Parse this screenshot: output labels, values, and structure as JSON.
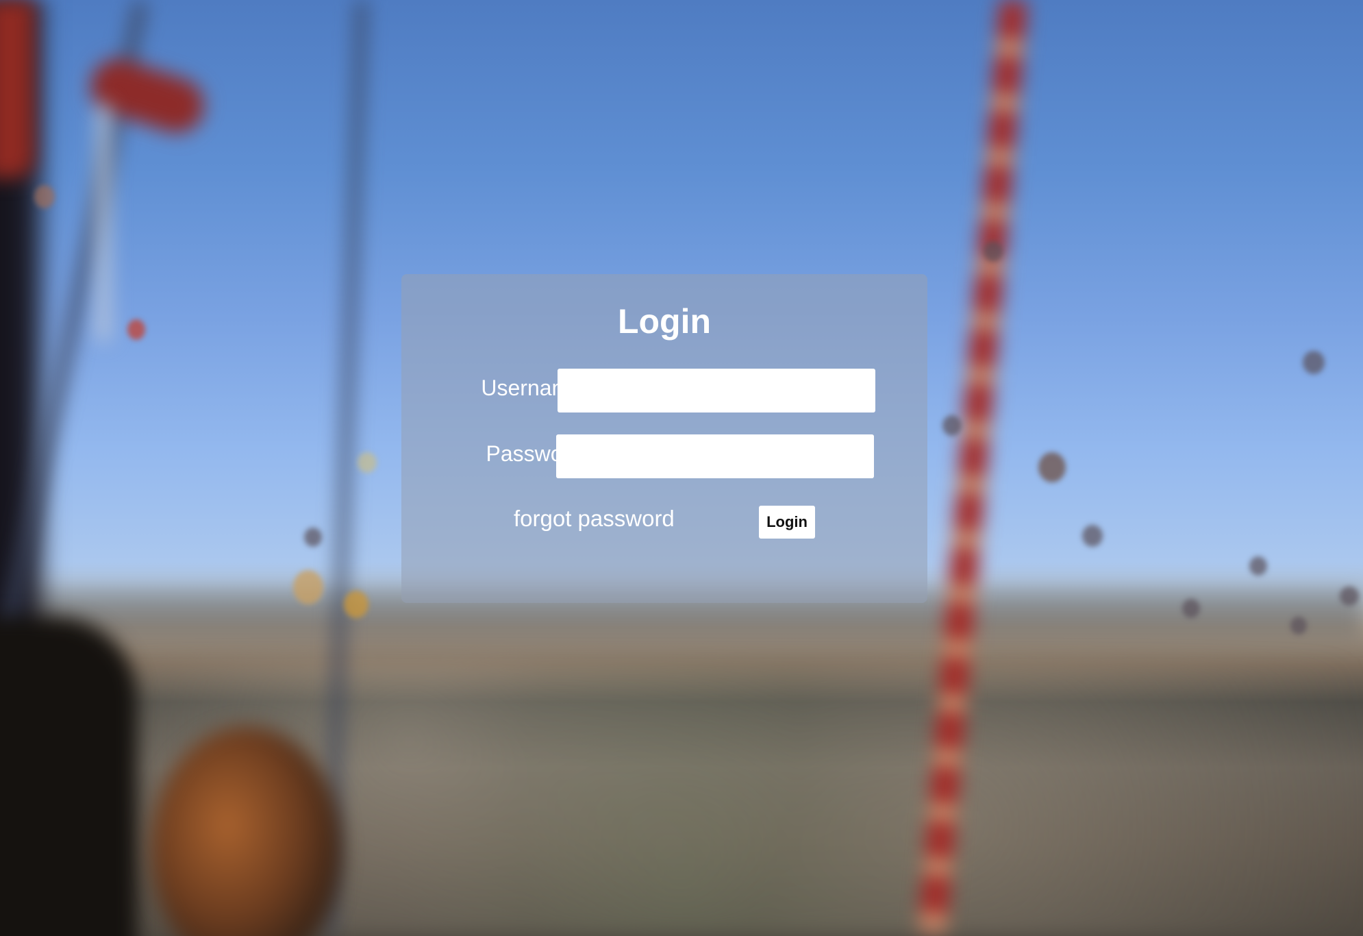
{
  "login": {
    "title": "Login",
    "username_label": "Username",
    "username_value": "",
    "password_label": "Password",
    "password_value": "",
    "forgot_password_link": "forgot password",
    "submit_label": "Login"
  },
  "colors": {
    "panel_background": "#96a0b4",
    "text": "#ffffff",
    "input_background": "#ffffff",
    "button_background": "#ffffff",
    "button_text": "#111111"
  }
}
